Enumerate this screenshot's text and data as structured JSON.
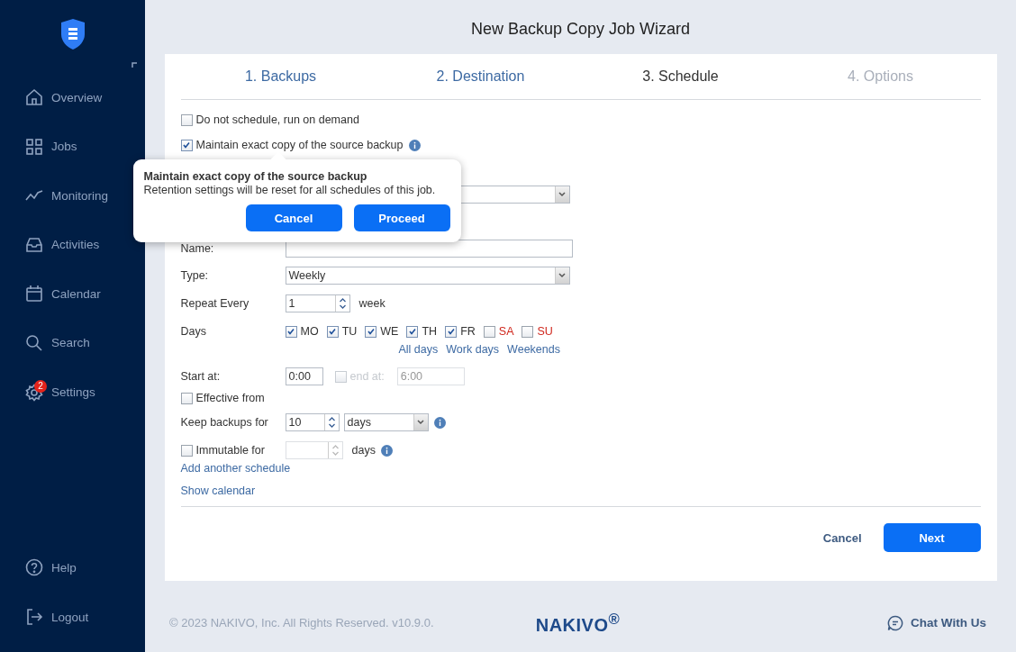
{
  "window": {
    "title": "New Backup Copy Job Wizard"
  },
  "sidebar": {
    "items": [
      {
        "label": "Overview"
      },
      {
        "label": "Jobs"
      },
      {
        "label": "Monitoring"
      },
      {
        "label": "Activities"
      },
      {
        "label": "Calendar"
      },
      {
        "label": "Search"
      },
      {
        "label": "Settings",
        "badge": "2"
      }
    ],
    "bottom_items": [
      {
        "label": "Help"
      },
      {
        "label": "Logout"
      }
    ]
  },
  "steps": [
    {
      "label": "1. Backups",
      "selected": false,
      "disabled": false
    },
    {
      "label": "2. Destination",
      "selected": false,
      "disabled": false
    },
    {
      "label": "3. Schedule",
      "selected": true,
      "disabled": false
    },
    {
      "label": "4. Options",
      "selected": false,
      "disabled": true
    }
  ],
  "options": [
    {
      "label": "Do not schedule, run on demand",
      "checked": false,
      "info": false
    },
    {
      "label": "Maintain exact copy of the source backup",
      "checked": true,
      "info": true
    }
  ],
  "schedule": {
    "name_label": "Name:",
    "type_label": "Type:",
    "type_value": "Weekly",
    "repeat_label": "Repeat Every",
    "repeat_value": "1",
    "repeat_unit": "week",
    "days_label": "Days",
    "days": [
      {
        "label": "MO",
        "checked": true,
        "color": "#333333"
      },
      {
        "label": "TU",
        "checked": true,
        "color": "#333333"
      },
      {
        "label": "WE",
        "checked": true,
        "color": "#333333"
      },
      {
        "label": "TH",
        "checked": true,
        "color": "#333333"
      },
      {
        "label": "FR",
        "checked": true,
        "color": "#333333"
      },
      {
        "label": "SA",
        "checked": false,
        "color": "#d0281e"
      },
      {
        "label": "SU",
        "checked": false,
        "color": "#d0281e"
      }
    ],
    "day_links": [
      "All days",
      "Work days",
      "Weekends"
    ],
    "start_label": "Start at:",
    "start_value": "0:00",
    "end_checked": false,
    "end_label": "end at:",
    "end_value": "6:00",
    "effective_label": "Effective from",
    "effective_checked": false,
    "keep_label": "Keep backups for",
    "keep_value": "10",
    "keep_unit": "days",
    "immutable_label": "Immutable for",
    "immutable_checked": false,
    "immutable_unit": "days"
  },
  "links": [
    "Add another schedule",
    "Show calendar"
  ],
  "buttons": {
    "cancel": "Cancel",
    "next": "Next"
  },
  "popover": {
    "title": "Maintain exact copy of the source backup",
    "text": "Retention settings will be reset for all schedules of this job.",
    "cancel": "Cancel",
    "proceed": "Proceed"
  },
  "footer": {
    "copyright": "© 2023 NAKIVO, Inc. All Rights Reserved. v10.9.0.",
    "logo": "NAKIVO$^{®}$",
    "chat": "Chat With Us"
  }
}
